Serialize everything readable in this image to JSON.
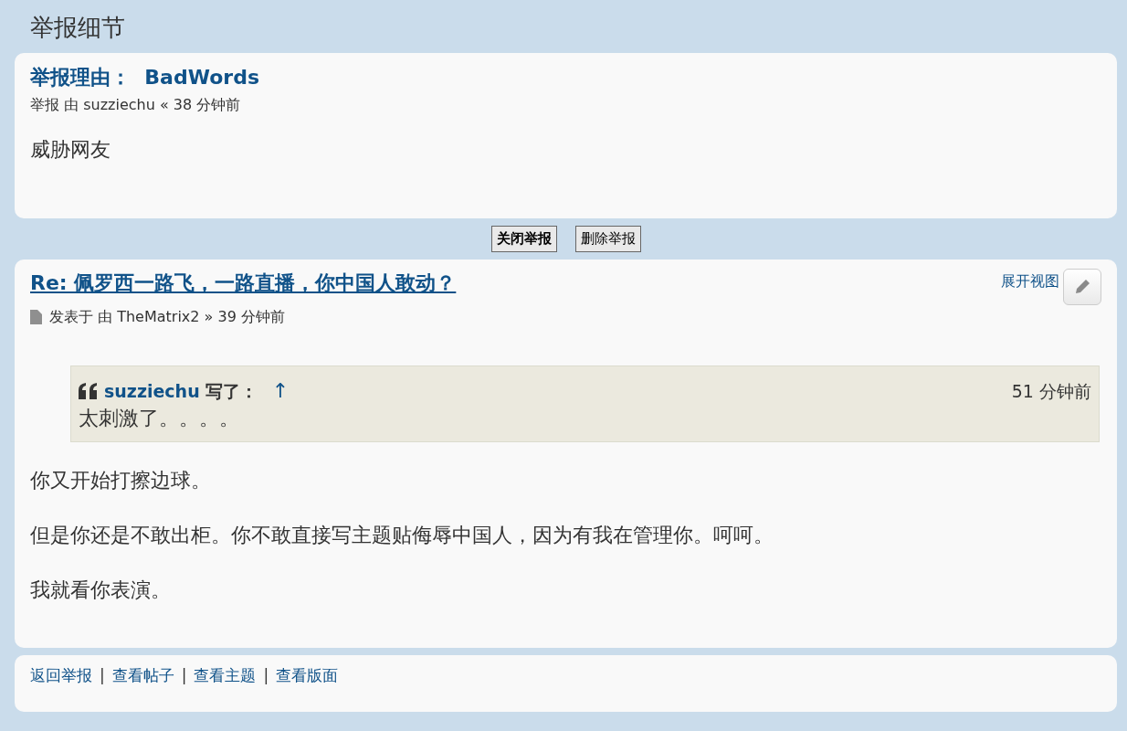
{
  "page_title": "举报细节",
  "report": {
    "reason_label": "举报理由：",
    "reason": "BadWords",
    "meta": "举报 由 suzziechu « 38 分钟前",
    "text": "威胁网友"
  },
  "buttons": [
    {
      "label": "关闭举报",
      "primary": true
    },
    {
      "label": "删除举报",
      "primary": false
    }
  ],
  "post": {
    "title": "Re: 佩罗西一路飞，一路直播，你中国人敢动？",
    "expand_label": "展开视图",
    "meta": "发表于 由 TheMatrix2 » 39 分钟前",
    "quote": {
      "author": "suzziechu",
      "wrote": "写了：",
      "jump": "↑",
      "time": "51 分钟前",
      "text": "太刺激了。。。。"
    },
    "paragraphs": [
      "你又开始打擦边球。",
      "但是你还是不敢出柜。你不敢直接写主题贴侮辱中国人，因为有我在管理你。呵呵。",
      "我就看你表演。"
    ]
  },
  "footer": [
    {
      "kind": "link",
      "text": "返回举报"
    },
    {
      "kind": "separator",
      "text": "|"
    },
    {
      "kind": "link",
      "text": "查看帖子"
    },
    {
      "kind": "separator",
      "text": "|"
    },
    {
      "kind": "link",
      "text": "查看主题"
    },
    {
      "kind": "separator",
      "text": "|"
    },
    {
      "kind": "link",
      "text": "查看版面"
    }
  ]
}
